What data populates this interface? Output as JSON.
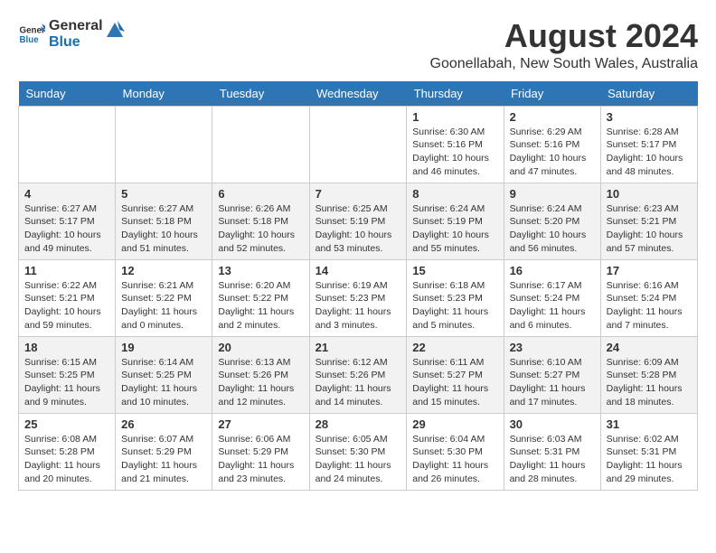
{
  "header": {
    "logo_general": "General",
    "logo_blue": "Blue",
    "month_year": "August 2024",
    "location": "Goonellabah, New South Wales, Australia"
  },
  "weekdays": [
    "Sunday",
    "Monday",
    "Tuesday",
    "Wednesday",
    "Thursday",
    "Friday",
    "Saturday"
  ],
  "weeks": [
    [
      {
        "day": "",
        "content": ""
      },
      {
        "day": "",
        "content": ""
      },
      {
        "day": "",
        "content": ""
      },
      {
        "day": "",
        "content": ""
      },
      {
        "day": "1",
        "content": "Sunrise: 6:30 AM\nSunset: 5:16 PM\nDaylight: 10 hours\nand 46 minutes."
      },
      {
        "day": "2",
        "content": "Sunrise: 6:29 AM\nSunset: 5:16 PM\nDaylight: 10 hours\nand 47 minutes."
      },
      {
        "day": "3",
        "content": "Sunrise: 6:28 AM\nSunset: 5:17 PM\nDaylight: 10 hours\nand 48 minutes."
      }
    ],
    [
      {
        "day": "4",
        "content": "Sunrise: 6:27 AM\nSunset: 5:17 PM\nDaylight: 10 hours\nand 49 minutes."
      },
      {
        "day": "5",
        "content": "Sunrise: 6:27 AM\nSunset: 5:18 PM\nDaylight: 10 hours\nand 51 minutes."
      },
      {
        "day": "6",
        "content": "Sunrise: 6:26 AM\nSunset: 5:18 PM\nDaylight: 10 hours\nand 52 minutes."
      },
      {
        "day": "7",
        "content": "Sunrise: 6:25 AM\nSunset: 5:19 PM\nDaylight: 10 hours\nand 53 minutes."
      },
      {
        "day": "8",
        "content": "Sunrise: 6:24 AM\nSunset: 5:19 PM\nDaylight: 10 hours\nand 55 minutes."
      },
      {
        "day": "9",
        "content": "Sunrise: 6:24 AM\nSunset: 5:20 PM\nDaylight: 10 hours\nand 56 minutes."
      },
      {
        "day": "10",
        "content": "Sunrise: 6:23 AM\nSunset: 5:21 PM\nDaylight: 10 hours\nand 57 minutes."
      }
    ],
    [
      {
        "day": "11",
        "content": "Sunrise: 6:22 AM\nSunset: 5:21 PM\nDaylight: 10 hours\nand 59 minutes."
      },
      {
        "day": "12",
        "content": "Sunrise: 6:21 AM\nSunset: 5:22 PM\nDaylight: 11 hours\nand 0 minutes."
      },
      {
        "day": "13",
        "content": "Sunrise: 6:20 AM\nSunset: 5:22 PM\nDaylight: 11 hours\nand 2 minutes."
      },
      {
        "day": "14",
        "content": "Sunrise: 6:19 AM\nSunset: 5:23 PM\nDaylight: 11 hours\nand 3 minutes."
      },
      {
        "day": "15",
        "content": "Sunrise: 6:18 AM\nSunset: 5:23 PM\nDaylight: 11 hours\nand 5 minutes."
      },
      {
        "day": "16",
        "content": "Sunrise: 6:17 AM\nSunset: 5:24 PM\nDaylight: 11 hours\nand 6 minutes."
      },
      {
        "day": "17",
        "content": "Sunrise: 6:16 AM\nSunset: 5:24 PM\nDaylight: 11 hours\nand 7 minutes."
      }
    ],
    [
      {
        "day": "18",
        "content": "Sunrise: 6:15 AM\nSunset: 5:25 PM\nDaylight: 11 hours\nand 9 minutes."
      },
      {
        "day": "19",
        "content": "Sunrise: 6:14 AM\nSunset: 5:25 PM\nDaylight: 11 hours\nand 10 minutes."
      },
      {
        "day": "20",
        "content": "Sunrise: 6:13 AM\nSunset: 5:26 PM\nDaylight: 11 hours\nand 12 minutes."
      },
      {
        "day": "21",
        "content": "Sunrise: 6:12 AM\nSunset: 5:26 PM\nDaylight: 11 hours\nand 14 minutes."
      },
      {
        "day": "22",
        "content": "Sunrise: 6:11 AM\nSunset: 5:27 PM\nDaylight: 11 hours\nand 15 minutes."
      },
      {
        "day": "23",
        "content": "Sunrise: 6:10 AM\nSunset: 5:27 PM\nDaylight: 11 hours\nand 17 minutes."
      },
      {
        "day": "24",
        "content": "Sunrise: 6:09 AM\nSunset: 5:28 PM\nDaylight: 11 hours\nand 18 minutes."
      }
    ],
    [
      {
        "day": "25",
        "content": "Sunrise: 6:08 AM\nSunset: 5:28 PM\nDaylight: 11 hours\nand 20 minutes."
      },
      {
        "day": "26",
        "content": "Sunrise: 6:07 AM\nSunset: 5:29 PM\nDaylight: 11 hours\nand 21 minutes."
      },
      {
        "day": "27",
        "content": "Sunrise: 6:06 AM\nSunset: 5:29 PM\nDaylight: 11 hours\nand 23 minutes."
      },
      {
        "day": "28",
        "content": "Sunrise: 6:05 AM\nSunset: 5:30 PM\nDaylight: 11 hours\nand 24 minutes."
      },
      {
        "day": "29",
        "content": "Sunrise: 6:04 AM\nSunset: 5:30 PM\nDaylight: 11 hours\nand 26 minutes."
      },
      {
        "day": "30",
        "content": "Sunrise: 6:03 AM\nSunset: 5:31 PM\nDaylight: 11 hours\nand 28 minutes."
      },
      {
        "day": "31",
        "content": "Sunrise: 6:02 AM\nSunset: 5:31 PM\nDaylight: 11 hours\nand 29 minutes."
      }
    ]
  ]
}
